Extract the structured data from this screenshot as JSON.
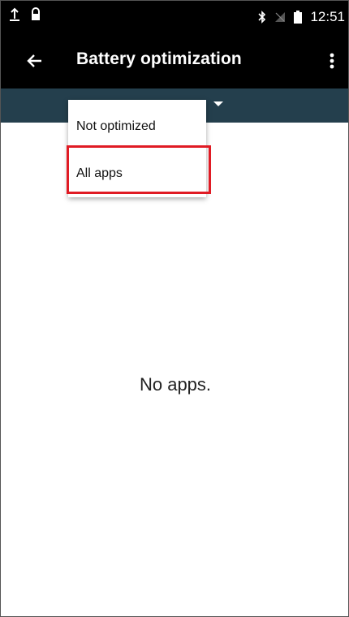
{
  "status_bar": {
    "time": "12:51",
    "icons": [
      "upload-icon",
      "lock-icon",
      "bluetooth-icon",
      "signal-off-icon",
      "battery-icon"
    ]
  },
  "app_bar": {
    "title": "Battery optimization",
    "back_icon": "back-arrow-icon",
    "menu_icon": "more-vert-icon"
  },
  "spinner": {
    "options": [
      "Not optimized",
      "All apps"
    ],
    "highlighted_option": "All apps"
  },
  "content": {
    "empty_text": "No apps."
  },
  "colors": {
    "app_bar": "#000000",
    "spinner_bar": "#243f4d",
    "highlight": "#e01b24"
  }
}
